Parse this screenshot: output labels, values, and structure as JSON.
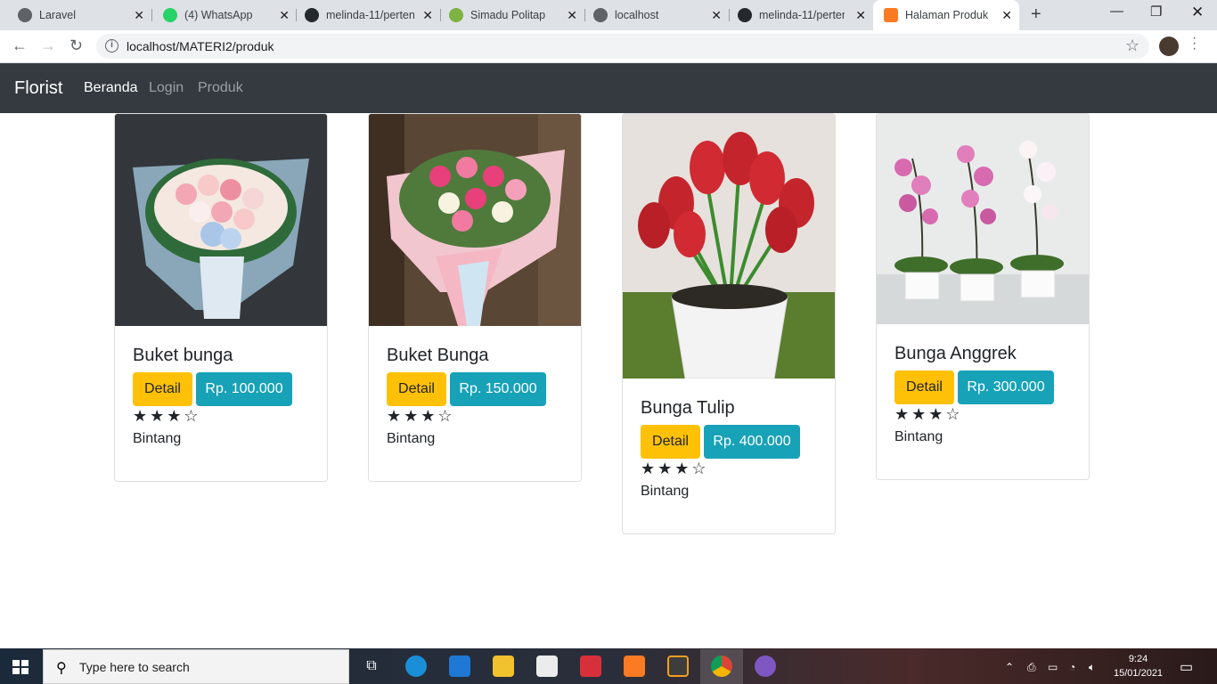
{
  "browser": {
    "tabs": [
      {
        "title": "Laravel",
        "color": "#5f6368"
      },
      {
        "title": "(4) WhatsApp",
        "color": "#25d366"
      },
      {
        "title": "melinda-11/perten",
        "color": "#24292e"
      },
      {
        "title": "Simadu Politap",
        "color": "#7cb342"
      },
      {
        "title": "localhost",
        "color": "#5f6368"
      },
      {
        "title": "melinda-11/perten",
        "color": "#24292e"
      },
      {
        "title": "Halaman Produk",
        "color": "#fb7a24"
      }
    ],
    "url": "localhost/MATERI2/produk"
  },
  "navbar": {
    "brand": "Florist",
    "links": [
      "Beranda",
      "Login",
      "Produk"
    ]
  },
  "products": [
    {
      "name": "Buket bunga",
      "detail": "Detail",
      "price": "Rp. 100.000",
      "stars": "★★★☆",
      "rating_label": "Bintang",
      "rating": 3
    },
    {
      "name": "Buket Bunga",
      "detail": "Detail",
      "price": "Rp. 150.000",
      "stars": "★★★☆",
      "rating_label": "Bintang",
      "rating": 3
    },
    {
      "name": "Bunga Tulip",
      "detail": "Detail",
      "price": "Rp. 400.000",
      "stars": "★★★☆",
      "rating_label": "Bintang",
      "rating": 3
    },
    {
      "name": "Bunga Anggrek",
      "detail": "Detail",
      "price": "Rp. 300.000",
      "stars": "★★★☆",
      "rating_label": "Bintang",
      "rating": 3
    }
  ],
  "taskbar": {
    "search_placeholder": "Type here to search",
    "time": "9:24",
    "date": "15/01/2021"
  }
}
